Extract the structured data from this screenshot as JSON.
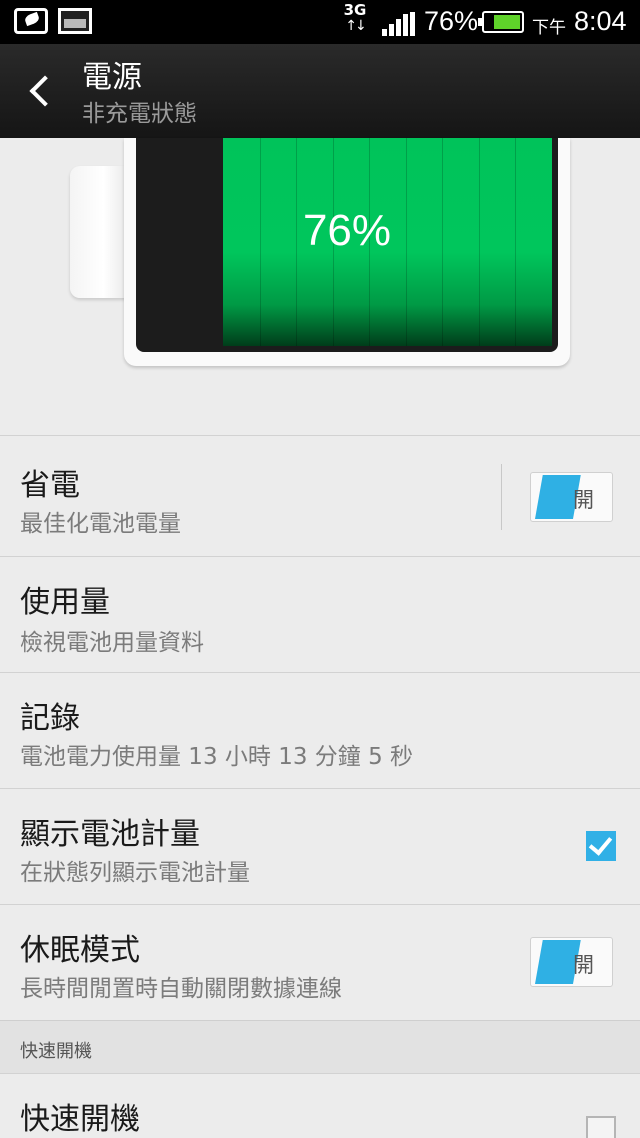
{
  "status_bar": {
    "network": "3G",
    "network_arrows": "↑↓",
    "battery_pct": "76%",
    "battery_level": 0.76,
    "ampm": "下午",
    "time": "8:04"
  },
  "action_bar": {
    "title": "電源",
    "subtitle": "非充電狀態",
    "back_icon": "chevron-left-icon"
  },
  "battery_graphic": {
    "percent_text": "76%",
    "level": 0.76,
    "fill_color": "#00c35a"
  },
  "settings": {
    "power_saver": {
      "title": "省電",
      "summary": "最佳化電池電量",
      "toggle_label": "開",
      "enabled": true
    },
    "usage": {
      "title": "使用量",
      "summary": "檢視電池用量資料"
    },
    "history": {
      "title": "記錄",
      "summary": "電池電力使用量 13 小時 13 分鐘 5 秒"
    },
    "show_battery_meter": {
      "title": "顯示電池計量",
      "summary": "在狀態列顯示電池計量",
      "checked": true
    },
    "sleep_mode": {
      "title": "休眠模式",
      "summary": "長時間閒置時自動關閉數據連線",
      "toggle_label": "開",
      "enabled": true
    }
  },
  "fast_boot_section": {
    "header": "快速開機",
    "item": {
      "title": "快速開機",
      "checked": false
    }
  },
  "colors": {
    "accent": "#31b0e6",
    "background": "#ececec",
    "status_bar": "#000000"
  }
}
